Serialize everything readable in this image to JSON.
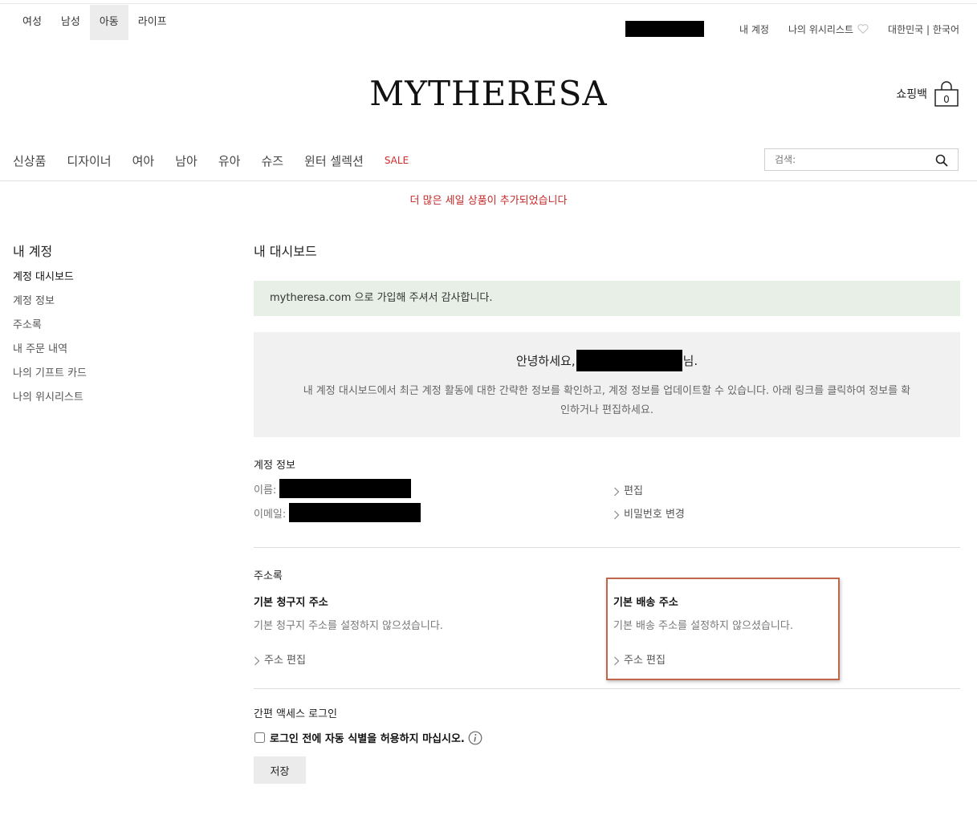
{
  "top_nav": [
    "여성",
    "남성",
    "아동",
    "라이프"
  ],
  "top_nav_active": "아동",
  "utility": {
    "account": "내 계정",
    "wishlist": "나의 위시리스트",
    "locale": "대한민국 | 한국어"
  },
  "logo": "MYTHERESA",
  "bag": {
    "label": "쇼핑백",
    "count": "0"
  },
  "main_nav": [
    "신상품",
    "디자이너",
    "여아",
    "남아",
    "유아",
    "슈즈",
    "윈터 셀렉션"
  ],
  "sale_label": "SALE",
  "search": {
    "placeholder": "검색:"
  },
  "promo": "더 많은 세일 상품이 추가되었습니다",
  "sidebar": {
    "title": "내 계정",
    "items": [
      "계정 대시보드",
      "계정 정보",
      "주소록",
      "내 주문 내역",
      "나의 기프트 카드",
      "나의 위시리스트"
    ]
  },
  "dashboard": {
    "title": "내 대시보드",
    "success": "mytheresa.com 으로 가입해 주셔서 감사합니다.",
    "hello_prefix": "안녕하세요,",
    "hello_suffix": "님.",
    "intro": "내 계정 대시보드에서 최근 계정 활동에 대한 간략한 정보를 확인하고, 계정 정보를 업데이트할 수 있습니다. 아래 링크를 클릭하여 정보를 확인하거나 편집하세요."
  },
  "account_info": {
    "title": "계정 정보",
    "name_label": "이름:",
    "email_label": "이메일:",
    "edit": "편집",
    "change_password": "비밀번호 변경"
  },
  "address_book": {
    "title": "주소록",
    "billing_title": "기본 청구지 주소",
    "billing_text": "기본 청구지 주소를 설정하지 않으셨습니다.",
    "shipping_title": "기본 배송 주소",
    "shipping_text": "기본 배송 주소를 설정하지 않으셨습니다.",
    "edit_address": "주소 편집"
  },
  "quick_access": {
    "title": "간편 액세스 로그인",
    "checkbox_label": "로그인 전에 자동 식별을 허용하지 마십시오.",
    "save": "저장"
  },
  "colors": {
    "sale": "#d32b2b",
    "success_bg": "#e7efe6",
    "highlight": "#c0664c"
  }
}
